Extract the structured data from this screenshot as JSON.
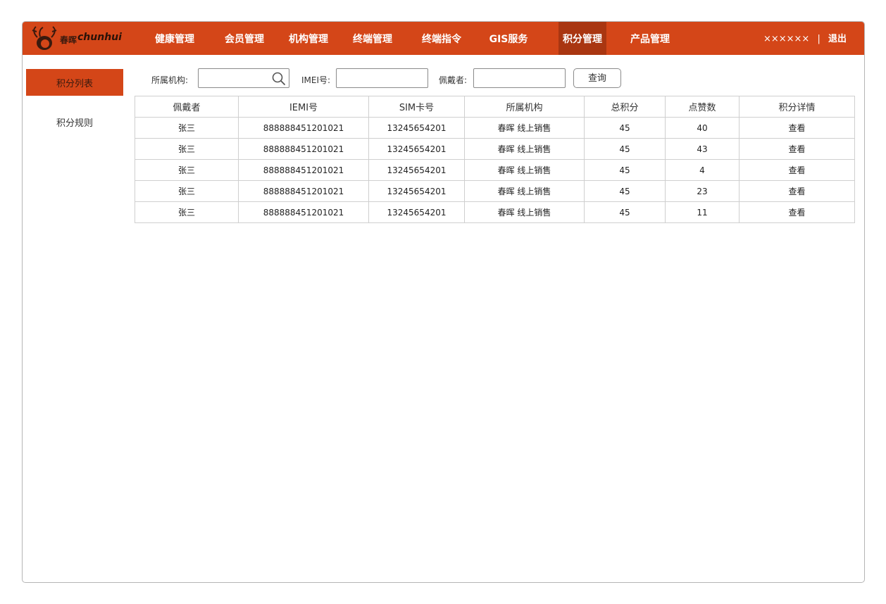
{
  "brand": {
    "cn": "春晖",
    "en": "chunhui",
    "logo_icon": "deer-head-logo"
  },
  "nav": {
    "items": [
      {
        "label": "健康管理"
      },
      {
        "label": "会员管理"
      },
      {
        "label": "机构管理"
      },
      {
        "label": "终端管理"
      },
      {
        "label": "终端指令"
      },
      {
        "label": "GIS服务"
      },
      {
        "label": "积分管理",
        "active": true
      },
      {
        "label": "产品管理"
      }
    ],
    "user": "××××××",
    "separator": "|",
    "logout": "退出"
  },
  "sidebar": {
    "items": [
      {
        "label": "积分列表",
        "active": true
      },
      {
        "label": "积分规则"
      }
    ]
  },
  "filters": {
    "org_label": "所属机构:",
    "org_value": "",
    "imei_label": "IMEI号:",
    "imei_value": "",
    "wearer_label": "佩戴者:",
    "wearer_value": "",
    "query_label": "查询"
  },
  "table": {
    "headers": [
      "佩戴者",
      "IEMI号",
      "SIM卡号",
      "所属机构",
      "总积分",
      "点赞数",
      "积分详情"
    ],
    "rows": [
      {
        "wearer": "张三",
        "imei": "888888451201021",
        "sim": "13245654201",
        "org": "春晖 线上销售",
        "total": "45",
        "likes": "40",
        "detail": "查看"
      },
      {
        "wearer": "张三",
        "imei": "888888451201021",
        "sim": "13245654201",
        "org": "春晖 线上销售",
        "total": "45",
        "likes": "43",
        "detail": "查看"
      },
      {
        "wearer": "张三",
        "imei": "888888451201021",
        "sim": "13245654201",
        "org": "春晖 线上销售",
        "total": "45",
        "likes": "4",
        "detail": "查看"
      },
      {
        "wearer": "张三",
        "imei": "888888451201021",
        "sim": "13245654201",
        "org": "春晖 线上销售",
        "total": "45",
        "likes": "23",
        "detail": "查看"
      },
      {
        "wearer": "张三",
        "imei": "888888451201021",
        "sim": "13245654201",
        "org": "春晖 线上销售",
        "total": "45",
        "likes": "11",
        "detail": "查看"
      }
    ]
  },
  "colors": {
    "brand_orange": "#d44618",
    "nav_active": "#a93611"
  }
}
